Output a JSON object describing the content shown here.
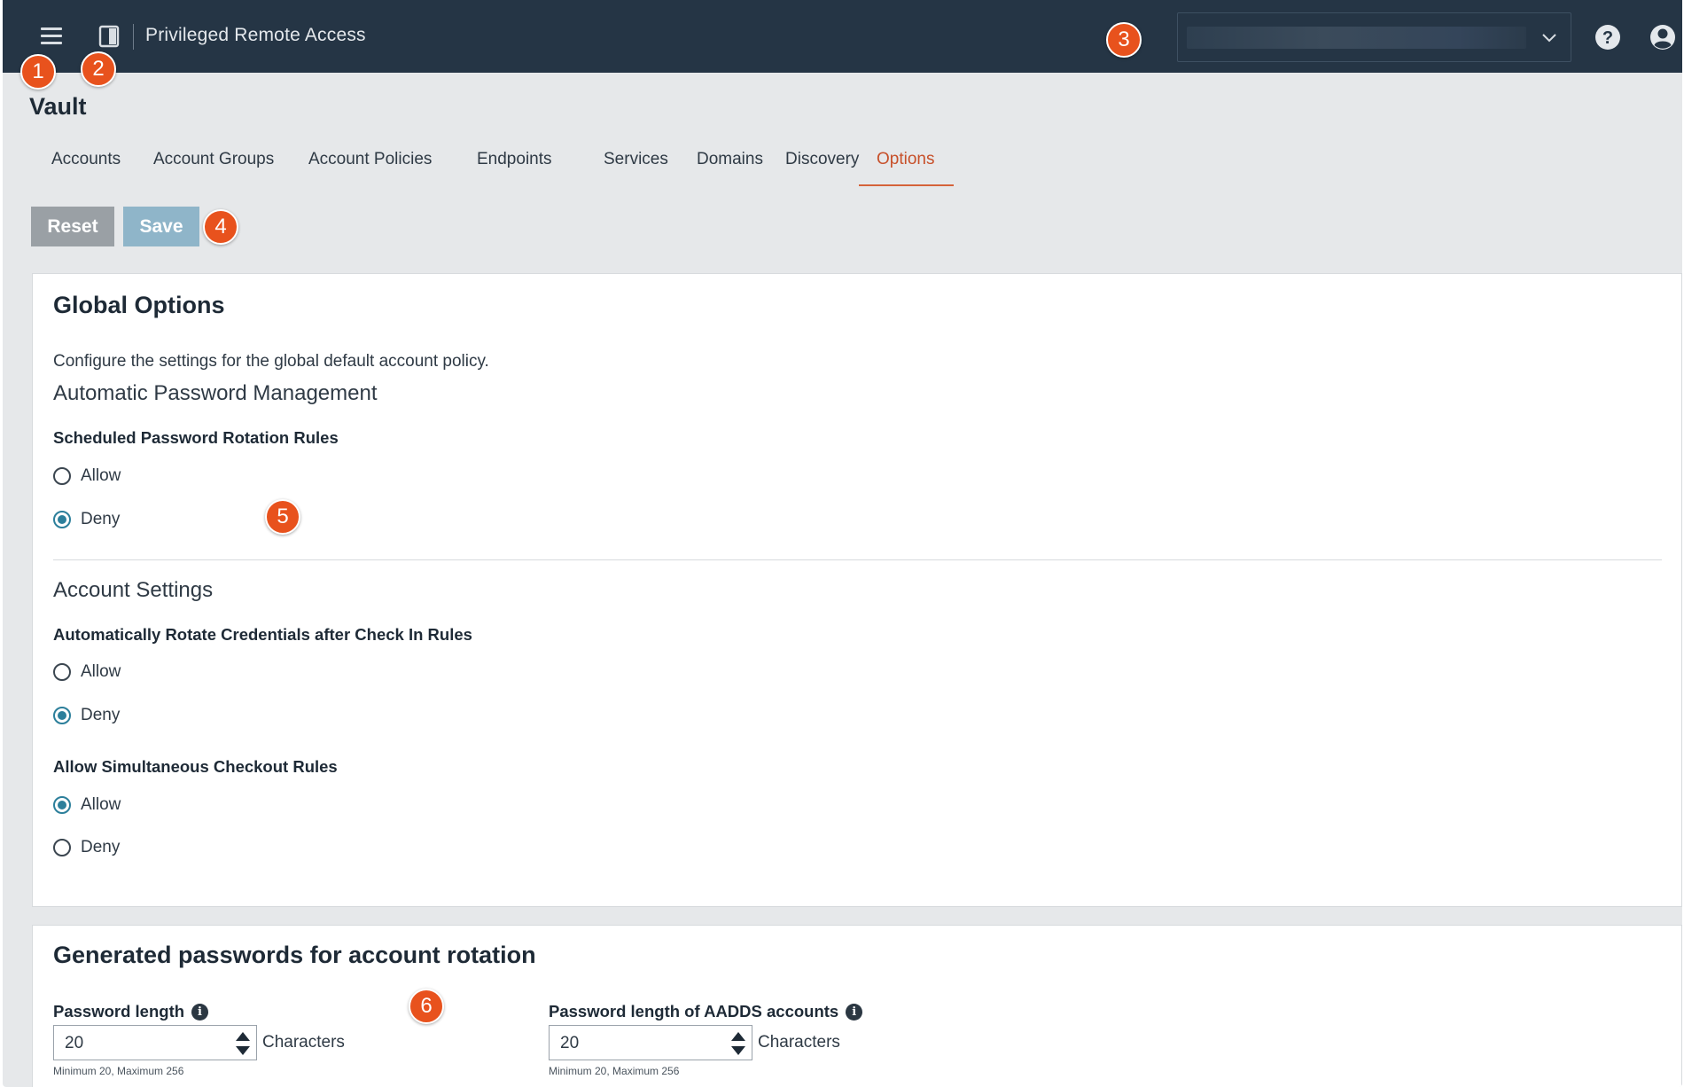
{
  "topbar": {
    "app_title": "Privileged Remote Access",
    "menu_icon": "hamburger-menu-icon",
    "panel_icon": "panel-toggle-icon",
    "help_icon": "help-icon",
    "user_icon": "user-account-icon"
  },
  "markers": [
    "1",
    "2",
    "3",
    "4",
    "5",
    "6"
  ],
  "page": {
    "title": "Vault"
  },
  "tabs": [
    {
      "label": "Accounts"
    },
    {
      "label": "Account Groups"
    },
    {
      "label": "Account Policies"
    },
    {
      "label": "Endpoints"
    },
    {
      "label": "Services"
    },
    {
      "label": "Domains"
    },
    {
      "label": "Discovery"
    },
    {
      "label": "Options",
      "active": true
    }
  ],
  "toolbar": {
    "reset_label": "Reset",
    "save_label": "Save"
  },
  "global_options": {
    "title": "Global Options",
    "description": "Configure the settings for the global default account policy.",
    "auto_pw_mgmt": {
      "heading": "Automatic Password Management",
      "scheduled_rotation": {
        "label": "Scheduled Password Rotation Rules",
        "options": [
          "Allow",
          "Deny"
        ],
        "selected": "Deny"
      }
    },
    "account_settings": {
      "heading": "Account Settings",
      "auto_rotate": {
        "label": "Automatically Rotate Credentials after Check In Rules",
        "options": [
          "Allow",
          "Deny"
        ],
        "selected": "Deny"
      },
      "simultaneous_checkout": {
        "label": "Allow Simultaneous Checkout Rules",
        "options": [
          "Allow",
          "Deny"
        ],
        "selected": "Allow"
      }
    }
  },
  "generated_passwords": {
    "title": "Generated passwords for account rotation",
    "password_length": {
      "label": "Password length",
      "value": "20",
      "unit": "Characters",
      "hint": "Minimum 20, Maximum 256"
    },
    "aadds_length": {
      "label": "Password length of AADDS accounts",
      "value": "20",
      "unit": "Characters",
      "hint": "Minimum 20, Maximum 256"
    }
  },
  "colors": {
    "topbar": "#253545",
    "accent": "#c7502a",
    "radio_checked": "#2c7f9b",
    "marker": "#e8521d"
  }
}
